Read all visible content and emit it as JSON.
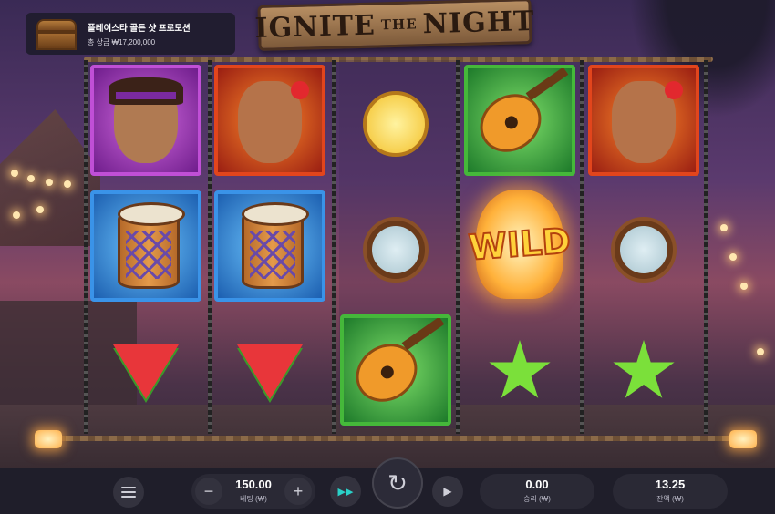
{
  "promo": {
    "title": "플레이스타 골든 샷 프로모션",
    "subtitle": "총 상금 ₩17,200,000",
    "icon": "treasure-chest-icon"
  },
  "logo": {
    "word1": "IGNITE",
    "word2": "THE",
    "word3": "NIGHT"
  },
  "reels": {
    "symbols": [
      [
        "man-portrait",
        "drum",
        "watermelon"
      ],
      [
        "woman-portrait",
        "drum",
        "watermelon"
      ],
      [
        "pineapple",
        "coconut",
        "guitar"
      ],
      [
        "guitar",
        "wild-lantern",
        "starfruit"
      ],
      [
        "woman-portrait",
        "coconut",
        "starfruit"
      ]
    ],
    "wild_label": "WILD"
  },
  "controls": {
    "bet_value": "150.00",
    "bet_label": "베팅 (₩)",
    "win_value": "0.00",
    "win_label": "승리 (₩)",
    "balance_value": "13.25",
    "balance_label": "잔액 (₩)",
    "minus": "−",
    "plus": "+",
    "spin_icon": "↻",
    "turbo_icon": "▶▶",
    "autoplay_icon": "▶"
  },
  "colors": {
    "bar_bg": "#1f1e2a",
    "turbo_accent": "#2ad0c8"
  }
}
